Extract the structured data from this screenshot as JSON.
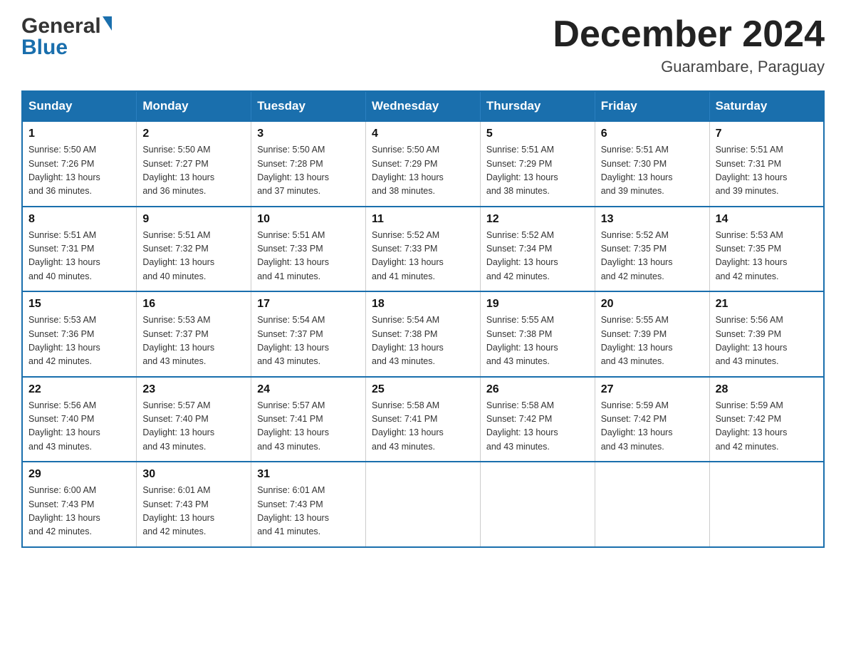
{
  "header": {
    "logo_general": "General",
    "logo_blue": "Blue",
    "title": "December 2024",
    "subtitle": "Guarambare, Paraguay"
  },
  "weekdays": [
    "Sunday",
    "Monday",
    "Tuesday",
    "Wednesday",
    "Thursday",
    "Friday",
    "Saturday"
  ],
  "weeks": [
    [
      {
        "day": "1",
        "sunrise": "5:50 AM",
        "sunset": "7:26 PM",
        "daylight": "13 hours and 36 minutes."
      },
      {
        "day": "2",
        "sunrise": "5:50 AM",
        "sunset": "7:27 PM",
        "daylight": "13 hours and 36 minutes."
      },
      {
        "day": "3",
        "sunrise": "5:50 AM",
        "sunset": "7:28 PM",
        "daylight": "13 hours and 37 minutes."
      },
      {
        "day": "4",
        "sunrise": "5:50 AM",
        "sunset": "7:29 PM",
        "daylight": "13 hours and 38 minutes."
      },
      {
        "day": "5",
        "sunrise": "5:51 AM",
        "sunset": "7:29 PM",
        "daylight": "13 hours and 38 minutes."
      },
      {
        "day": "6",
        "sunrise": "5:51 AM",
        "sunset": "7:30 PM",
        "daylight": "13 hours and 39 minutes."
      },
      {
        "day": "7",
        "sunrise": "5:51 AM",
        "sunset": "7:31 PM",
        "daylight": "13 hours and 39 minutes."
      }
    ],
    [
      {
        "day": "8",
        "sunrise": "5:51 AM",
        "sunset": "7:31 PM",
        "daylight": "13 hours and 40 minutes."
      },
      {
        "day": "9",
        "sunrise": "5:51 AM",
        "sunset": "7:32 PM",
        "daylight": "13 hours and 40 minutes."
      },
      {
        "day": "10",
        "sunrise": "5:51 AM",
        "sunset": "7:33 PM",
        "daylight": "13 hours and 41 minutes."
      },
      {
        "day": "11",
        "sunrise": "5:52 AM",
        "sunset": "7:33 PM",
        "daylight": "13 hours and 41 minutes."
      },
      {
        "day": "12",
        "sunrise": "5:52 AM",
        "sunset": "7:34 PM",
        "daylight": "13 hours and 42 minutes."
      },
      {
        "day": "13",
        "sunrise": "5:52 AM",
        "sunset": "7:35 PM",
        "daylight": "13 hours and 42 minutes."
      },
      {
        "day": "14",
        "sunrise": "5:53 AM",
        "sunset": "7:35 PM",
        "daylight": "13 hours and 42 minutes."
      }
    ],
    [
      {
        "day": "15",
        "sunrise": "5:53 AM",
        "sunset": "7:36 PM",
        "daylight": "13 hours and 42 minutes."
      },
      {
        "day": "16",
        "sunrise": "5:53 AM",
        "sunset": "7:37 PM",
        "daylight": "13 hours and 43 minutes."
      },
      {
        "day": "17",
        "sunrise": "5:54 AM",
        "sunset": "7:37 PM",
        "daylight": "13 hours and 43 minutes."
      },
      {
        "day": "18",
        "sunrise": "5:54 AM",
        "sunset": "7:38 PM",
        "daylight": "13 hours and 43 minutes."
      },
      {
        "day": "19",
        "sunrise": "5:55 AM",
        "sunset": "7:38 PM",
        "daylight": "13 hours and 43 minutes."
      },
      {
        "day": "20",
        "sunrise": "5:55 AM",
        "sunset": "7:39 PM",
        "daylight": "13 hours and 43 minutes."
      },
      {
        "day": "21",
        "sunrise": "5:56 AM",
        "sunset": "7:39 PM",
        "daylight": "13 hours and 43 minutes."
      }
    ],
    [
      {
        "day": "22",
        "sunrise": "5:56 AM",
        "sunset": "7:40 PM",
        "daylight": "13 hours and 43 minutes."
      },
      {
        "day": "23",
        "sunrise": "5:57 AM",
        "sunset": "7:40 PM",
        "daylight": "13 hours and 43 minutes."
      },
      {
        "day": "24",
        "sunrise": "5:57 AM",
        "sunset": "7:41 PM",
        "daylight": "13 hours and 43 minutes."
      },
      {
        "day": "25",
        "sunrise": "5:58 AM",
        "sunset": "7:41 PM",
        "daylight": "13 hours and 43 minutes."
      },
      {
        "day": "26",
        "sunrise": "5:58 AM",
        "sunset": "7:42 PM",
        "daylight": "13 hours and 43 minutes."
      },
      {
        "day": "27",
        "sunrise": "5:59 AM",
        "sunset": "7:42 PM",
        "daylight": "13 hours and 43 minutes."
      },
      {
        "day": "28",
        "sunrise": "5:59 AM",
        "sunset": "7:42 PM",
        "daylight": "13 hours and 42 minutes."
      }
    ],
    [
      {
        "day": "29",
        "sunrise": "6:00 AM",
        "sunset": "7:43 PM",
        "daylight": "13 hours and 42 minutes."
      },
      {
        "day": "30",
        "sunrise": "6:01 AM",
        "sunset": "7:43 PM",
        "daylight": "13 hours and 42 minutes."
      },
      {
        "day": "31",
        "sunrise": "6:01 AM",
        "sunset": "7:43 PM",
        "daylight": "13 hours and 41 minutes."
      },
      null,
      null,
      null,
      null
    ]
  ],
  "labels": {
    "sunrise": "Sunrise:",
    "sunset": "Sunset:",
    "daylight": "Daylight:"
  }
}
